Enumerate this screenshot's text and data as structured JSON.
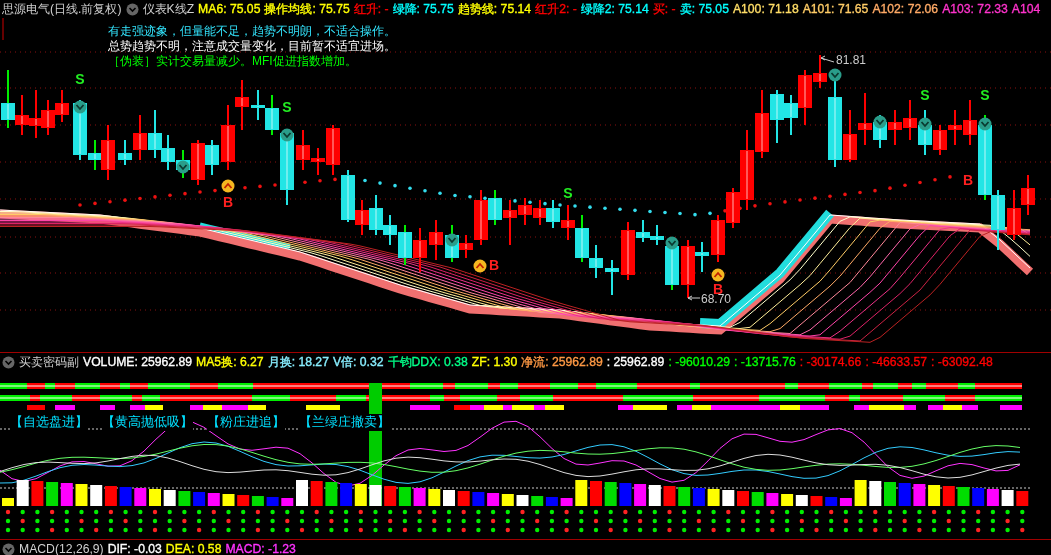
{
  "header": {
    "stock": "思源电气(日线.前复权)",
    "indicator": "仪表K线Z",
    "values": [
      {
        "text": "MA6: 75.05",
        "color": "#ffff00"
      },
      {
        "text": "操作均线: 75.75",
        "color": "#ffff00"
      },
      {
        "text": "红升: -",
        "color": "#ff0000"
      },
      {
        "text": "绿降: 75.75",
        "color": "#00ffff"
      },
      {
        "text": "趋势线: 75.14",
        "color": "#ffff00"
      },
      {
        "text": "红升2: -",
        "color": "#ff0000"
      },
      {
        "text": "绿降2: 75.14",
        "color": "#00ffff"
      },
      {
        "text": "买: -",
        "color": "#ff0000"
      },
      {
        "text": "卖: 75.05",
        "color": "#00ffff"
      },
      {
        "text": "A100: 71.18",
        "color": "#ffdd66"
      },
      {
        "text": "A101: 71.65",
        "color": "#ffcc66"
      },
      {
        "text": "A102: 72.06",
        "color": "#ffaa66"
      },
      {
        "text": "A103: 72.33",
        "color": "#ff33cc"
      },
      {
        "text": "A104",
        "color": "#ff33cc"
      }
    ]
  },
  "messages": [
    {
      "text": "有走强迹象，但量能不足，趋势不明朗，不适合操作。",
      "color": "#33e6ff"
    },
    {
      "text": "总势趋势不明，注意成交量变化，目前暂不适宜进场。",
      "color": "#ffffff"
    },
    {
      "text": "［伪装］实计交易量减少。MFI促进指数增加。",
      "color": "#00ff00"
    }
  ],
  "chart": {
    "high_label": "81.81",
    "low_label": "68.70",
    "signals": [
      {
        "kind": "sell",
        "text": "S"
      },
      {
        "kind": "sell",
        "text": "S"
      },
      {
        "kind": "sell",
        "text": "S"
      },
      {
        "kind": "sell",
        "text": "S"
      },
      {
        "kind": "sell",
        "text": "S"
      },
      {
        "kind": "buy",
        "text": "B"
      },
      {
        "kind": "buy",
        "text": "B"
      },
      {
        "kind": "buy",
        "text": "B"
      },
      {
        "kind": "buy",
        "text": "B"
      }
    ]
  },
  "sub_panel": {
    "title": "买卖密码副",
    "values": [
      {
        "text": "VOLUME: 25962.89",
        "color": "#ffffff"
      },
      {
        "text": "MA5换: 6.27",
        "color": "#ffff00"
      },
      {
        "text": "月换: 18.27",
        "color": "#88eeff"
      },
      {
        "text": "V倍: 0.32",
        "color": "#88eeff"
      },
      {
        "text": "千钧DDX: 0.38",
        "color": "#00ff88"
      },
      {
        "text": "ZF: 1.30",
        "color": "#ffff00"
      },
      {
        "text": "净流: 25962.89",
        "color": "#ff9944"
      },
      {
        "text": ": 25962.89",
        "color": "#ffffff"
      },
      {
        "text": ": -96010.29",
        "color": "#00ff00"
      },
      {
        "text": ": -13715.76",
        "color": "#00ff00"
      },
      {
        "text": ": -30174.66",
        "color": "#ff0000"
      },
      {
        "text": ": -46633.57",
        "color": "#ff0000"
      },
      {
        "text": ": -63092.48",
        "color": "#ff0000"
      }
    ],
    "tags": [
      "【自选盘进】",
      "【黄高抛低吸】",
      "【粉庄进追】",
      "【兰绿庄撤卖】"
    ]
  },
  "footer": {
    "title": "MACD(12,26,9)",
    "values": [
      {
        "text": "DIF: -0.03",
        "color": "#ffffff"
      },
      {
        "text": "DEA: 0.58",
        "color": "#ffff00"
      },
      {
        "text": "MACD: -1.23",
        "color": "#ff33ff"
      }
    ]
  }
}
